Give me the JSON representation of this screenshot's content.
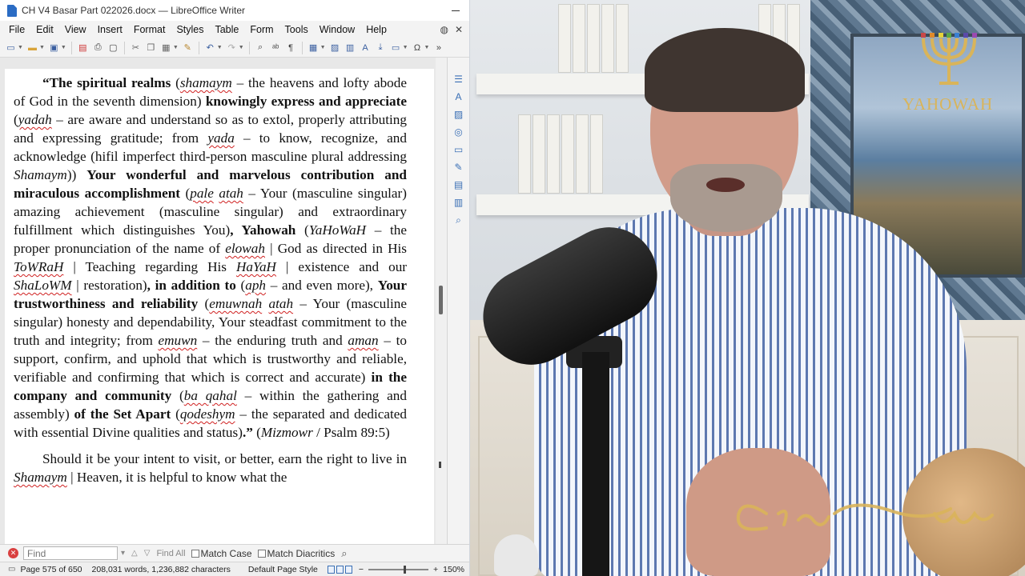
{
  "window": {
    "title": "CH V4 Basar Part 022026.docx — LibreOffice Writer"
  },
  "menu": [
    "File",
    "Edit",
    "View",
    "Insert",
    "Format",
    "Styles",
    "Table",
    "Form",
    "Tools",
    "Window",
    "Help"
  ],
  "toolbar_icons": [
    "new-document-icon",
    "open-folder-icon",
    "save-icon",
    "export-pdf-icon",
    "print-icon",
    "print-preview-icon",
    "cut-icon",
    "copy-icon",
    "paste-icon",
    "clone-formatting-icon",
    "undo-icon",
    "redo-icon",
    "find-replace-icon",
    "spelling-icon",
    "formatting-marks-icon",
    "insert-table-icon",
    "insert-image-icon",
    "insert-chart-icon",
    "insert-textbox-icon",
    "page-break-icon",
    "insert-field-icon",
    "special-character-icon"
  ],
  "document": {
    "paragraph1": {
      "quote_open": "“The spiritual realms",
      "p1_a": " (",
      "shamaym": "shamaym",
      "p1_b": " – the heavens and lofty abode of God in the seventh dimension) ",
      "knowingly": "knowingly express and appreciate",
      "p1_c": " (",
      "yadah": "yadah",
      "p1_d": " – are aware and understand so as to extol, properly attributing and expressing gratitude; from ",
      "yada": "yada",
      "p1_e": " – to know, recognize, and acknowledge (hifil imperfect third-person masculine plural addressing ",
      "shamaym2": "Shamaym",
      "p1_f": ")) ",
      "wonderful": "Your wonderful and marvelous contribution and miraculous accomplishment",
      "p1_g": " (",
      "pale": "pale",
      "p1_h": " ",
      "atah": "atah",
      "p1_i": " – Your (masculine singular) amazing achievement (masculine singular) and extraordinary fulfillment which distinguishes You)",
      "yahowah": ", Yahowah",
      "p1_j": " (",
      "yahowah_it": "YaHoWaH",
      "p1_k": " – the proper pronunciation of the name of ",
      "elowah": "elowah",
      "p1_l": " | God as directed in His ",
      "towrah": "ToWRaH",
      "p1_m": " | Teaching regarding His ",
      "hayah": "HaYaH",
      "p1_n": " | existence and our ",
      "shalowm": "ShaLoWM",
      "p1_o": " | restoration)",
      "addition": ", in addition to",
      "p1_p": " (",
      "aph": "aph",
      "p1_q": " – and even more), ",
      "trust": "Your trustworthiness and reliability",
      "p1_r": " (",
      "emuwnah": "emuwnah",
      "p1_s": " ",
      "atah2": "atah",
      "p1_t": " – Your (masculine singular) honesty and dependability, Your steadfast commitment to the truth and integrity; from ",
      "emuwn": "emuwn",
      "p1_u": " – the enduring truth and ",
      "aman": "aman",
      "p1_v": " – to support, confirm, and uphold that which is trustworthy and reliable, verifiable and confirming that which is correct and accurate) ",
      "company": "in the company and community",
      "p1_w": " (",
      "ba_qahal": "ba qahal",
      "p1_x": " – within the gathering and assembly) ",
      "set_apart": "of the Set Apart",
      "p1_y": " (",
      "qodeshym": "qodeshym",
      "p1_z": " – the separated and dedicated with essential Divine qualities and status)",
      "quote_close": ".”",
      "p1_end": " (",
      "mizmowr": "Mizmowr",
      "p1_ref": " / Psalm 89:5)"
    },
    "paragraph2": {
      "text_a": "Should it be your intent to visit, or better, earn the right to live in ",
      "shamaym": "Shamaym",
      "text_b": " | Heaven, it is helpful to know what the"
    }
  },
  "findbar": {
    "placeholder": "Find",
    "find_all": "Find All",
    "match_case": "Match Case",
    "match_diacritics": "Match Diacritics"
  },
  "statusbar": {
    "page": "Page 575 of 650",
    "counts": "208,031 words, 1,236,882 characters",
    "page_style": "Default Page Style",
    "zoom": "150%"
  },
  "video": {
    "logo_text": "YAHOWAH",
    "signature": "Craig Winn"
  },
  "colors": {
    "spellcheck_underline": "#d02020",
    "logo_gold": "#d9b45a",
    "accent_blue": "#3a6fb5"
  }
}
